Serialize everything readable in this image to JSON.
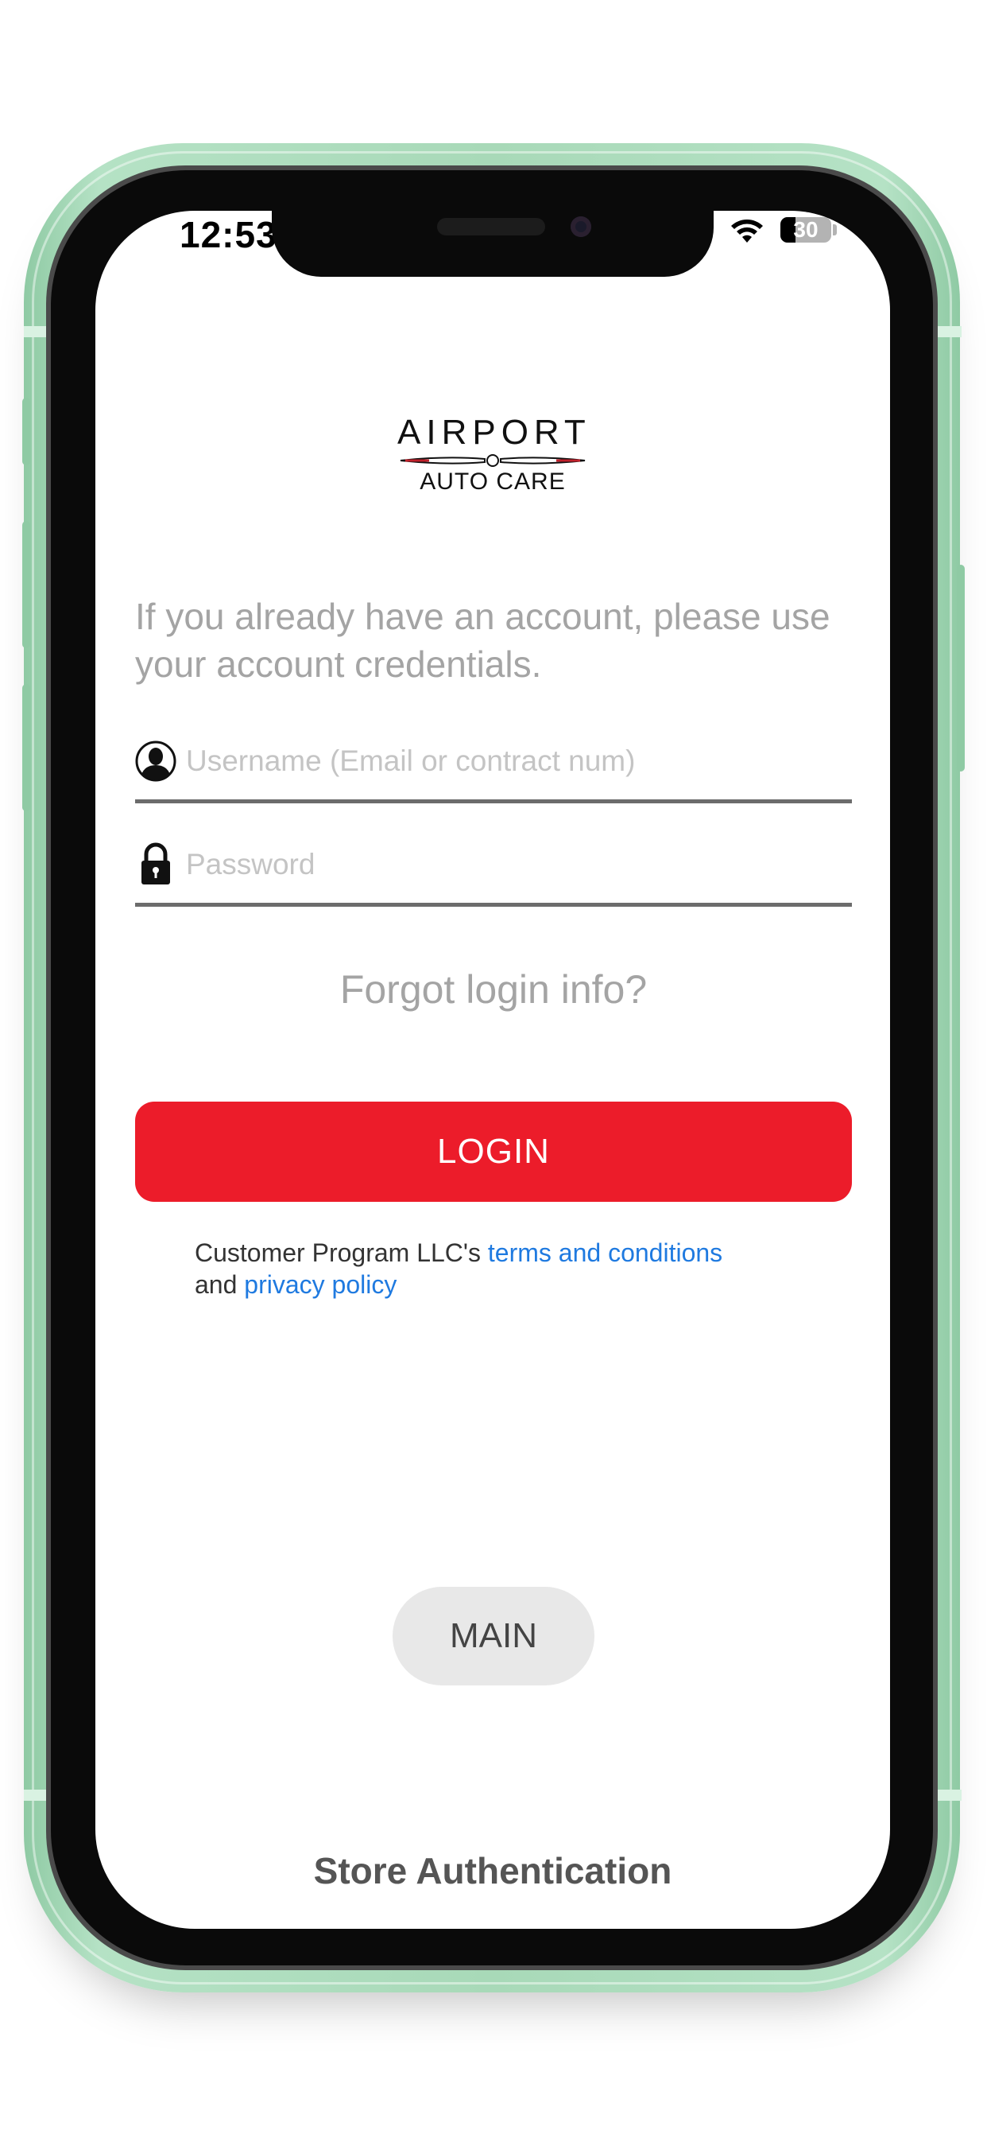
{
  "status_bar": {
    "time": "12:53",
    "battery_level": "30",
    "battery_fraction": 0.3,
    "wifi_icon": "wifi-icon"
  },
  "logo": {
    "line1": "AIRPORT",
    "line2": "AUTO CARE"
  },
  "intro_text": "If you already have an account, please use your account credentials.",
  "fields": {
    "username": {
      "placeholder": "Username (Email or contract num)",
      "value": "",
      "icon": "user-silhouette-icon"
    },
    "password": {
      "placeholder": "Password",
      "value": "",
      "icon": "lock-icon"
    }
  },
  "forgot_label": "Forgot login info?",
  "login_label": "LOGIN",
  "legal": {
    "prefix": "Customer Program LLC's ",
    "terms_link": "terms and conditions",
    "connector": "and ",
    "privacy_link": "privacy policy"
  },
  "main_button_label": "MAIN",
  "footer_title": "Store Authentication",
  "colors": {
    "accent_red": "#ec1c2a",
    "link_blue": "#1f7ae0",
    "phone_frame": "#a8d9b8",
    "muted_text": "#a4a4a4"
  }
}
